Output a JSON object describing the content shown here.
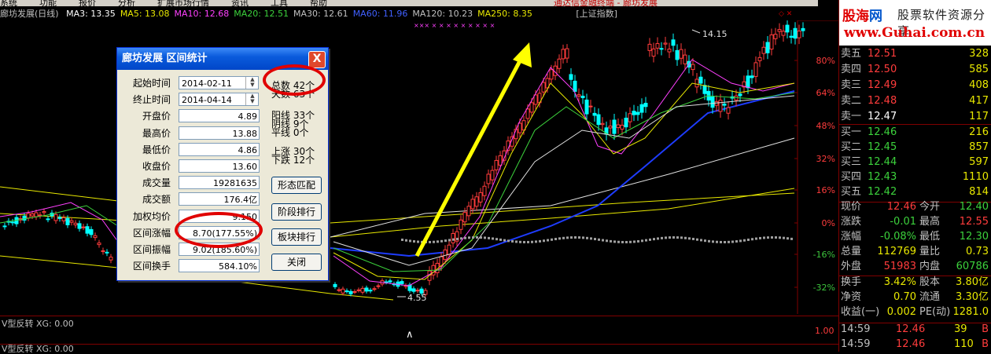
{
  "menubar": {
    "items": [
      "系统",
      "功能",
      "报价",
      "分析",
      "扩展市场行情",
      "资讯",
      "工具",
      "帮助"
    ],
    "marquee": "通达信金融终端 - 廊坊发展"
  },
  "chart_header": {
    "stock": "廊坊发展(日线)",
    "indicators": [
      {
        "label": "MA3: 13.35",
        "color": "#ffffff"
      },
      {
        "label": "MA5: 13.08",
        "color": "#e8e800"
      },
      {
        "label": "MA10: 12.68",
        "color": "#ff40ff"
      },
      {
        "label": "MA20: 12.51",
        "color": "#3cd23c"
      },
      {
        "label": "MA30: 12.61",
        "color": "#c0c0c0"
      },
      {
        "label": "MA60: 11.96",
        "color": "#4060ff"
      },
      {
        "label": "MA120: 10.23",
        "color": "#c0c0c0"
      },
      {
        "label": "MA250: 8.35",
        "color": "#e8e800"
      }
    ],
    "index_tag": "[上证指数]"
  },
  "chart": {
    "price_axis": [
      {
        "label": "80%",
        "color": "#ff3c3c"
      },
      {
        "label": "64%",
        "color": "#ff3c3c"
      },
      {
        "label": "48%",
        "color": "#ff3c3c"
      },
      {
        "label": "32%",
        "color": "#ff3c3c"
      },
      {
        "label": "16%",
        "color": "#ff3c3c"
      },
      {
        "label": "0%",
        "color": "#ff3c3c"
      },
      {
        "label": "-16%",
        "color": "#3cc43c"
      },
      {
        "label": "-32%",
        "color": "#3cc43c"
      }
    ],
    "high_mark": "14.15",
    "low_mark": "4.55",
    "indicator_axis": "1.00"
  },
  "indicator1": {
    "label": "V型反转 XG: 0.00"
  },
  "indicator2": {
    "label": "V型反转 XG: 0.00"
  },
  "logo": {
    "brand_a": "股海",
    "brand_b": "网",
    "slogan": "股票软件资源分享",
    "url": "www.Guhai.com.cn"
  },
  "order_book": {
    "sells": [
      {
        "label": "卖五",
        "price": "12.51",
        "vol": "328"
      },
      {
        "label": "卖四",
        "price": "12.50",
        "vol": "585"
      },
      {
        "label": "卖三",
        "price": "12.49",
        "vol": "408"
      },
      {
        "label": "卖二",
        "price": "12.48",
        "vol": "417"
      },
      {
        "label": "卖一",
        "price": "12.47",
        "vol": "117"
      }
    ],
    "buys": [
      {
        "label": "买一",
        "price": "12.46",
        "vol": "216"
      },
      {
        "label": "买二",
        "price": "12.45",
        "vol": "857"
      },
      {
        "label": "买三",
        "price": "12.44",
        "vol": "597"
      },
      {
        "label": "买四",
        "price": "12.43",
        "vol": "1110"
      },
      {
        "label": "买五",
        "price": "12.42",
        "vol": "814"
      }
    ]
  },
  "quote": [
    {
      "k1": "现价",
      "v1": "12.46",
      "c1": "#ff3c3c",
      "k2": "今开",
      "v2": "12.40",
      "c2": "#3cd23c"
    },
    {
      "k1": "涨跌",
      "v1": "-0.01",
      "c1": "#3cd23c",
      "k2": "最高",
      "v2": "12.55",
      "c2": "#ff3c3c"
    },
    {
      "k1": "涨幅",
      "v1": "-0.08%",
      "c1": "#3cd23c",
      "k2": "最低",
      "v2": "12.30",
      "c2": "#3cd23c"
    },
    {
      "k1": "总量",
      "v1": "112769",
      "c1": "#e8e800",
      "k2": "量比",
      "v2": "0.73",
      "c2": "#e8e800"
    },
    {
      "k1": "外盘",
      "v1": "51983",
      "c1": "#ff3c3c",
      "k2": "内盘",
      "v2": "60786",
      "c2": "#3cd23c"
    }
  ],
  "fundamentals": [
    {
      "k1": "换手",
      "v1": "3.42%",
      "k2": "股本",
      "v2": "3.80亿"
    },
    {
      "k1": "净资",
      "v1": "0.70",
      "k2": "流通",
      "v2": "3.30亿"
    },
    {
      "k1": "收益(一)",
      "v1": "0.002",
      "k2": "PE(动)",
      "v2": "1281.0"
    }
  ],
  "ticks": [
    {
      "time": "14:59",
      "price": "12.46",
      "vol": "39",
      "side": "B"
    },
    {
      "time": "14:59",
      "price": "12.46",
      "vol": "110",
      "side": "B"
    }
  ],
  "dialog": {
    "title": "廊坊发展  区间统计",
    "close_label": "X",
    "fields": [
      {
        "label": "起始时间",
        "value": "2014-02-11",
        "type": "date"
      },
      {
        "label": "终止时间",
        "value": "2014-04-14",
        "type": "date"
      },
      {
        "label": "开盘价",
        "value": "4.89"
      },
      {
        "label": "最高价",
        "value": "13.88"
      },
      {
        "label": "最低价",
        "value": "4.86"
      },
      {
        "label": "收盘价",
        "value": "13.60"
      },
      {
        "label": "成交量",
        "value": "19281635"
      },
      {
        "label": "成交额",
        "value": "176.4亿"
      },
      {
        "label": "加权均价",
        "value": "9.150"
      },
      {
        "label": "区间涨幅",
        "value": "8.70(177.55%)"
      },
      {
        "label": "区间振幅",
        "value": "9.02(185.60%)"
      },
      {
        "label": "区间换手",
        "value": "584.10%"
      }
    ],
    "stats": [
      {
        "label": "总数  42个"
      },
      {
        "label": "天数  63个"
      },
      {
        "label": "阳线  33个"
      },
      {
        "label": "阴线  9个"
      },
      {
        "label": "平线  0个"
      },
      {
        "label": "上涨  30个"
      },
      {
        "label": "下跌  12个"
      }
    ],
    "buttons": [
      "形态匹配",
      "阶段排行",
      "板块排行",
      "关闭"
    ]
  }
}
